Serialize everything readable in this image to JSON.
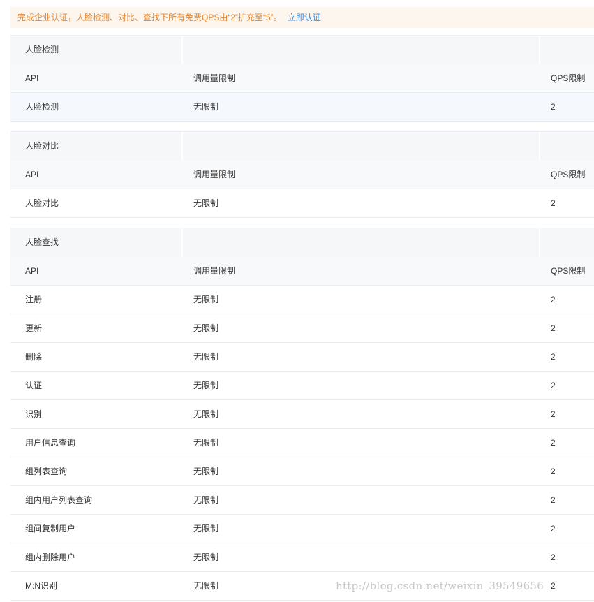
{
  "notice": {
    "text": "完成企业认证，人脸检测、对比、查找下所有免费QPS由“2”扩充至“5”。",
    "link": "立即认证"
  },
  "columns": {
    "api": "API",
    "limit": "调用量限制",
    "qps": "QPS限制"
  },
  "sections": [
    {
      "title": "人脸检测",
      "rows": [
        {
          "api": "人脸检测",
          "limit": "无限制",
          "qps": "2"
        }
      ]
    },
    {
      "title": "人脸对比",
      "rows": [
        {
          "api": "人脸对比",
          "limit": "无限制",
          "qps": "2"
        }
      ]
    },
    {
      "title": "人脸查找",
      "rows": [
        {
          "api": "注册",
          "limit": "无限制",
          "qps": "2"
        },
        {
          "api": "更新",
          "limit": "无限制",
          "qps": "2"
        },
        {
          "api": "删除",
          "limit": "无限制",
          "qps": "2"
        },
        {
          "api": "认证",
          "limit": "无限制",
          "qps": "2"
        },
        {
          "api": "识别",
          "limit": "无限制",
          "qps": "2"
        },
        {
          "api": "用户信息查询",
          "limit": "无限制",
          "qps": "2"
        },
        {
          "api": "组列表查询",
          "limit": "无限制",
          "qps": "2"
        },
        {
          "api": "组内用户列表查询",
          "limit": "无限制",
          "qps": "2"
        },
        {
          "api": "组间复制用户",
          "limit": "无限制",
          "qps": "2"
        },
        {
          "api": "组内删除用户",
          "limit": "无限制",
          "qps": "2"
        },
        {
          "api": "M:N识别",
          "limit": "无限制",
          "qps": "2"
        }
      ]
    }
  ],
  "watermark": "http://blog.csdn.net/weixin_39549656"
}
